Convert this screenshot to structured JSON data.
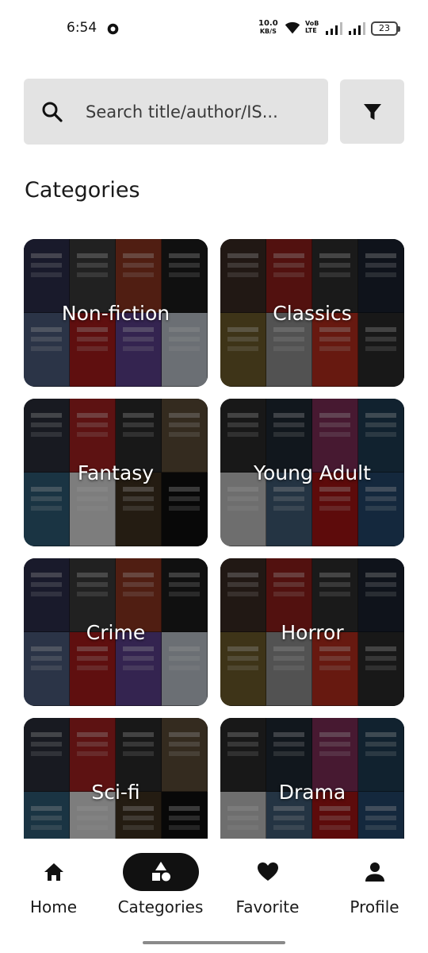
{
  "status_bar": {
    "time": "6:54",
    "net_speed_value": "10.0",
    "net_speed_unit": "KB/S",
    "volte_top": "VoB",
    "volte_bottom": "LTE",
    "battery": "23",
    "icons": [
      "notification-dot-icon",
      "wifi-icon",
      "volte-icon",
      "signal-icon",
      "signal-icon",
      "battery-icon"
    ]
  },
  "search": {
    "placeholder": "Search title/author/IS...",
    "value": "",
    "icon": "search-icon",
    "filter_icon": "filter-icon"
  },
  "section_title": "Categories",
  "categories": [
    {
      "label": "Non-fiction"
    },
    {
      "label": "Classics"
    },
    {
      "label": "Fantasy"
    },
    {
      "label": "Young Adult"
    },
    {
      "label": "Crime"
    },
    {
      "label": "Horror"
    },
    {
      "label": "Sci-fi"
    },
    {
      "label": "Drama"
    }
  ],
  "bottom_nav": {
    "items": [
      {
        "label": "Home",
        "icon": "home-icon",
        "active": false
      },
      {
        "label": "Categories",
        "icon": "categories-icon",
        "active": true
      },
      {
        "label": "Favorite",
        "icon": "heart-icon",
        "active": false
      },
      {
        "label": "Profile",
        "icon": "person-icon",
        "active": false
      }
    ]
  },
  "colors": {
    "search_background": "#e3e3e3",
    "active_nav_pill": "#111111",
    "text_primary": "#1a1a1a"
  }
}
